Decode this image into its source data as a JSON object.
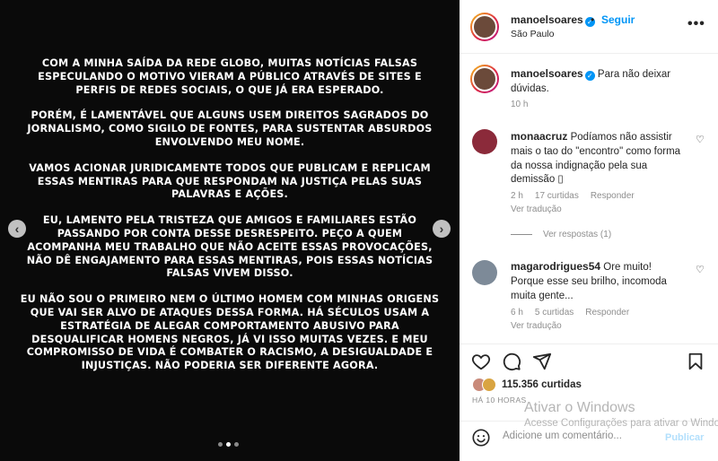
{
  "post": {
    "paragraphs": [
      "Com a minha saída da Rede Globo, muitas notícias falsas especulando o motivo vieram a público através de sites e perfis de redes sociais, o que já era esperado.",
      "Porém, é lamentável que alguns usem direitos sagrados do jornalismo, como sigilo de fontes, para sustentar absurdos envolvendo meu nome.",
      "Vamos acionar juridicamente todos que publicam e replicam essas mentiras para que respondam na justiça pelas suas palavras e ações.",
      "Eu, lamento pela tristeza que amigos e familiares estão passando por conta desse desrespeito. Peço a quem acompanha meu trabalho que não aceite essas provocações, não dê engajamento para essas mentiras, pois essas notícias falsas vivem disso.",
      "Eu não sou o primeiro nem o último homem com minhas origens que vai ser alvo de ataques dessa forma. Há séculos usam a estratégia de alegar comportamento abusivo para desqualificar homens negros, já vi isso muitas vezes. E meu compromisso de vida é combater o racismo, a desigualdade e injustiças. Não poderia ser diferente agora."
    ],
    "carousel": {
      "total": 3,
      "current": 2
    }
  },
  "header": {
    "username": "manoelsoares",
    "separator": "•",
    "follow_label": "Seguir",
    "location": "São Paulo",
    "more_label": "•••"
  },
  "caption": {
    "username": "manoelsoares",
    "text": "Para não deixar dúvidas.",
    "time": "10 h"
  },
  "comments": [
    {
      "username": "monaacruz",
      "text": "Podíamos não assistir mais o tao do \"encontro\" como forma da nossa indignação pela sua demissão ▯",
      "time": "2 h",
      "likes": "17 curtidas",
      "reply": "Responder",
      "translate": "Ver tradução",
      "replies": "Ver respostas (1)"
    },
    {
      "username": "magarodrigues54",
      "text": "Ore muito! Porque esse seu brilho, incomoda muita gente...",
      "time": "6 h",
      "likes": "5 curtidas",
      "reply": "Responder",
      "translate": "Ver tradução"
    }
  ],
  "actions": {
    "likes": "115.356 curtidas",
    "time": "HÁ 10 HORAS"
  },
  "add_comment": {
    "placeholder": "Adicione um comentário...",
    "publish_label": "Publicar"
  },
  "watermark": {
    "title": "Ativar o Windows",
    "subtitle": "Acesse Configurações para ativar o Windows."
  },
  "colors": {
    "accent": "#0095f6",
    "verified": "#0095f6",
    "publish_disabled": "#b2dffc"
  }
}
